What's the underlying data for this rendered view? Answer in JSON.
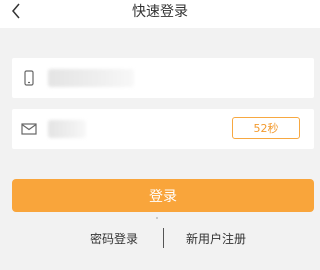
{
  "header": {
    "title": "快速登录",
    "back_icon": "chevron-left-icon"
  },
  "phone_field": {
    "icon": "phone-icon"
  },
  "code_field": {
    "icon": "mail-icon",
    "countdown_label": "52秒"
  },
  "login_button": {
    "label": "登录"
  },
  "footer": {
    "password_login_label": "密码登录",
    "register_label": "新用户注册"
  },
  "colors": {
    "accent": "#f9a53b",
    "countdown_border": "#f7a841",
    "background": "#f2f2f2"
  }
}
